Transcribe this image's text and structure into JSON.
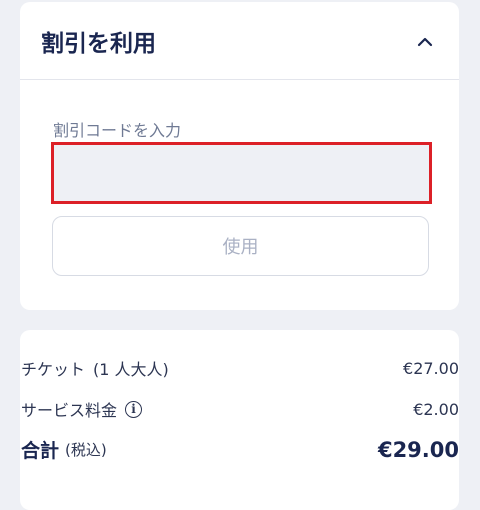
{
  "discount": {
    "title": "割引を利用",
    "field_label": "割引コードを入力",
    "input_value": "",
    "input_placeholder": "",
    "apply_label": "使用",
    "expanded": true
  },
  "summary": {
    "ticket_label": "チケット",
    "ticket_qualifier": "(1 人大人)",
    "ticket_price": "€27.00",
    "fee_label": "サービス料金",
    "fee_price": "€2.00",
    "total_label": "合計",
    "total_qualifier": "(税込)",
    "total_price": "€29.00"
  },
  "colors": {
    "error_border": "#dc2027",
    "title_text": "#1a2650",
    "background": "#eef0f5"
  },
  "icons": {
    "collapse": "chevron-up-icon",
    "info": "info-icon"
  }
}
